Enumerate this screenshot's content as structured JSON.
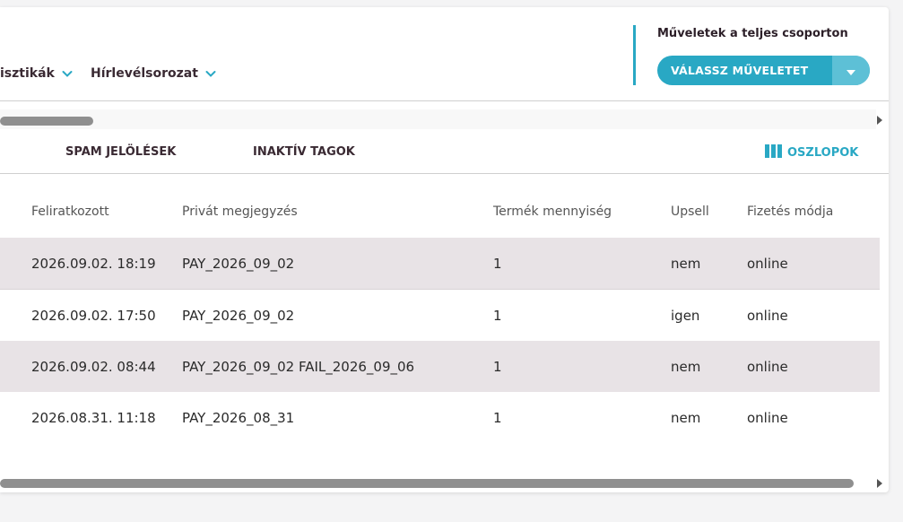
{
  "menu": {
    "items": [
      {
        "label": "isztikák"
      },
      {
        "label": "Hírlevélsorozat"
      }
    ]
  },
  "group_actions": {
    "label": "Műveletek a teljes csoporton",
    "button_label": "VÁLASSZ MŰVELETET"
  },
  "tabs": [
    {
      "label": "SPAM JELÖLÉSEK"
    },
    {
      "label": "INAKTÍV TAGOK"
    }
  ],
  "columns_button": {
    "label": "OSZLOPOK",
    "icon": "columns-icon"
  },
  "table": {
    "headers": [
      "Feliratkozott",
      "Privát megjegyzés",
      "Termék mennyiség",
      "Upsell",
      "Fizetés módja"
    ],
    "rows": [
      [
        "2026.09.02. 18:19",
        "PAY_2026_09_02",
        "1",
        "nem",
        "online"
      ],
      [
        "2026.09.02. 17:50",
        "PAY_2026_09_02",
        "1",
        "igen",
        "online"
      ],
      [
        "2026.09.02. 08:44",
        "PAY_2026_09_02 FAIL_2026_09_06",
        "1",
        "nem",
        "online"
      ],
      [
        "2026.08.31. 11:18",
        "PAY_2026_08_31",
        "1",
        "nem",
        "online"
      ]
    ]
  },
  "colors": {
    "accent": "#29a8c4",
    "accent_light": "#5dc0d6",
    "row_shade": "#e8e3e6",
    "heading_text": "#3a2a33"
  }
}
